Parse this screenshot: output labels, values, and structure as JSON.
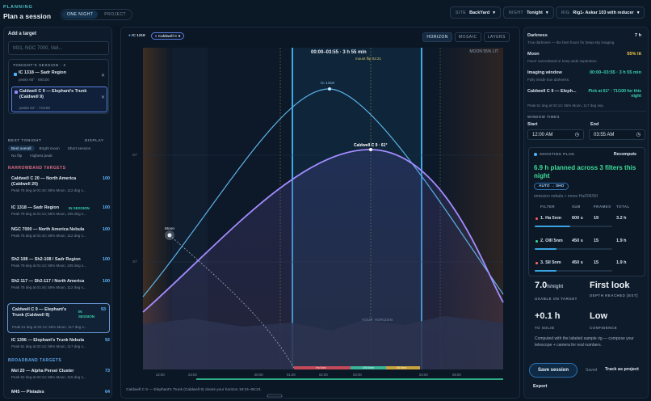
{
  "header": {
    "kicker": "PLANNING",
    "title": "Plan a session",
    "mode_tabs": [
      "ONE NIGHT",
      "PROJECT"
    ],
    "site": {
      "label": "SITE",
      "value": "BackYard"
    },
    "night": {
      "label": "NIGHT",
      "value": "Tonight"
    },
    "rig": {
      "label": "RIG",
      "value": "Rig1- Askar 103 with reducer"
    }
  },
  "left": {
    "add_label": "Add a target",
    "search_placeholder": "M31, NGC 7000, Veil...",
    "session_header": "TONIGHT'S SESSION · 2",
    "session": [
      {
        "name": "IC 1318 — Sadr Region",
        "sub": "peaks 65° · 68/100",
        "color": "#4fb3ff"
      },
      {
        "name": "Caldwell C 9 — Elephant's Trunk (Caldwell 9)",
        "sub": "peaks 61° · 71/100",
        "color": "#9a86ff"
      }
    ],
    "best_header": "BEST TONIGHT",
    "display_label": "DISPLAY",
    "filters": [
      "Best overall",
      "Bright moon",
      "Short session",
      "No flip",
      "Highest peak"
    ],
    "narrow_header": "NARROWBAND TARGETS",
    "broad_header": "BROADBAND TARGETS",
    "in_session": "IN SESSION",
    "targets": [
      {
        "name": "Caldwell C 20 — North America (Caldwell 20)",
        "sub": "Peak 75 deg at 01:44; 55% Moon, 112 deg s...",
        "score": "100"
      },
      {
        "name": "IC 1318 — Sadr Region",
        "sub": "Peak 79 deg at 01:14; 55% Moon, 105 deg s...",
        "score": "100"
      },
      {
        "name": "NGC 7000 — North America Nebula",
        "sub": "Peak 75 deg at 01:44; 55% Moon, 112 deg s...",
        "score": "100"
      },
      {
        "name": "Sh2 108 — Sh2-108 / Sadr Region",
        "sub": "Peak 79 deg at 01:14; 55% Moon, 105 deg s...",
        "score": "100"
      },
      {
        "name": "Sh2 117 — Sh2-117 / North America",
        "sub": "Peak 75 deg at 01:44; 55% Moon, 112 deg s...",
        "score": "100"
      },
      {
        "name": "Caldwell C 9 — Elephant's Trunk (Caldwell 9)",
        "sub": "Peak 61 deg at 02:14; 55% Moon, 117 deg s...",
        "score": "93"
      },
      {
        "name": "IC 1396 — Elephant's Trunk Nebula",
        "sub": "Peak 61 deg at 02:14; 55% Moon, 117 deg s...",
        "score": "92"
      },
      {
        "name": "Mel 20 — Alpha Persei Cluster",
        "sub": "Peak 52 deg at 04:14; 55% Moon, 115 deg s...",
        "score": "73"
      },
      {
        "name": "M45 — Pleiades",
        "sub": "",
        "score": "64"
      }
    ]
  },
  "center": {
    "chips": [
      "IC 1318",
      "Caldwell C 9"
    ],
    "views": [
      "HORIZON",
      "MOSAIC",
      "LAYERS"
    ],
    "window_text": "00:00–03:55 · 3 h 55 min",
    "flip_text": "mount flip 02:21",
    "moon_lit": "MOON 55% LIT",
    "moon_label": "Moon",
    "curve1_label": "IC 1318",
    "curve2_label": "Caldwell C 9 · 61°",
    "horizon_label": "YOUR HORIZON",
    "seg_labels": [
      "Ha 5nm",
      "OIII 5nm",
      "SII 5nm"
    ],
    "hours": [
      "22:00",
      "23:00",
      "00:00",
      "01:00",
      "02:00",
      "03:00",
      "04:00",
      "05:00"
    ],
    "ticks": [
      "60°",
      "30°"
    ],
    "caption": "Caldwell C 9 — Elephant's Trunk (Caldwell 9) clears your horizon 19:24–06:24."
  },
  "right": {
    "info": [
      {
        "label": "Darkness",
        "sub": "True darkness — the best hours for deep-sky imaging.",
        "value": "7 h",
        "color": "#e6edf5"
      },
      {
        "label": "Moon",
        "sub": "Favor narrowband or keep wide separation.",
        "value": "55% lit",
        "color": "#f2c94c"
      },
      {
        "label": "Imaging window",
        "sub": "Fully inside true darkness.",
        "value": "00:00–03:55 · 3 h 55 min",
        "color": "#38d2b0"
      },
      {
        "label": "Caldwell C 9 — Eleph...",
        "sub": "Peak 61 deg at 02:14; 55% Moon, 117 deg sep.",
        "value": "Pick at 61° · 71/100 for this night",
        "color": "#38d2b0"
      }
    ],
    "window_times": "WINDOW TIMES",
    "start_label": "Start",
    "end_label": "End",
    "start": "12:00 AM",
    "end": "03:55 AM",
    "plan_header": "SHOOTING PLAN",
    "recompute": "Recompute",
    "plan_title": "6.9 h planned across 3 filters this night",
    "auto": "AUTO → SHO",
    "plan_sub": "emission nebula + mono Ha/OIII/SII",
    "cols": [
      "FILTER",
      "SUB",
      "FRAMES",
      "TOTAL"
    ],
    "rows": [
      {
        "name": "1. Ha 5nm",
        "sub": "600 s",
        "frames": "19",
        "total": "3.2 h",
        "color": "#ff5d5d",
        "fill": 0.46
      },
      {
        "name": "2. OIII 5nm",
        "sub": "450 s",
        "frames": "15",
        "total": "1.9 h",
        "color": "#3ddc97",
        "fill": 0.28
      },
      {
        "name": "3. SII 5nm",
        "sub": "450 s",
        "frames": "15",
        "total": "1.9 h",
        "color": "#ff6f6f",
        "fill": 0.28
      }
    ],
    "stats": [
      {
        "value": "7.0",
        "unit": "h/night",
        "label": "USABLE ON TARGET"
      },
      {
        "value": "First look",
        "unit": "",
        "label": "DEPTH REACHED [EST]"
      },
      {
        "value": "+0.1 h",
        "unit": "",
        "label": "TO SOLID"
      },
      {
        "value": "Low",
        "unit": "",
        "label": "CONFIDENCE"
      }
    ],
    "note": "Computed with the labeled sample rig — compose your telescope + camera for real numbers.",
    "save": "Save session",
    "saved": "Saved",
    "track": "Track as project",
    "export": "Export"
  }
}
